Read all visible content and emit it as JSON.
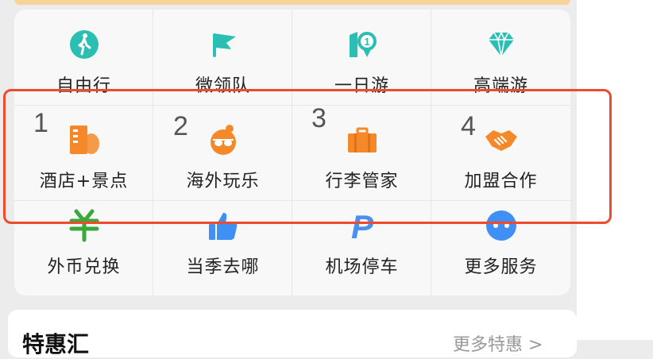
{
  "grid": {
    "row1": [
      {
        "label": "自由行",
        "icon": "hiking-icon"
      },
      {
        "label": "微领队",
        "icon": "flag-icon"
      },
      {
        "label": "一日游",
        "icon": "day-one-icon"
      },
      {
        "label": "高端游",
        "icon": "diamond-icon"
      }
    ],
    "row2": [
      {
        "label": "酒店+景点",
        "icon": "hotel-building-icon",
        "num": "1"
      },
      {
        "label": "海外玩乐",
        "icon": "sunglasses-face-icon",
        "num": "2"
      },
      {
        "label": "行李管家",
        "icon": "luggage-icon",
        "num": "3"
      },
      {
        "label": "加盟合作",
        "icon": "handshake-icon",
        "num": "4"
      }
    ],
    "row3": [
      {
        "label": "外币兑换",
        "icon": "currency-exchange-icon"
      },
      {
        "label": "当季去哪",
        "icon": "thumbs-up-icon"
      },
      {
        "label": "机场停车",
        "icon": "parking-icon"
      },
      {
        "label": "更多服务",
        "icon": "more-dots-icon"
      }
    ]
  },
  "bottom": {
    "title": "特惠汇",
    "link": "更多特惠 >"
  },
  "colors": {
    "teal": "#2bbfb3",
    "orange": "#f5892a",
    "blue": "#3f8ff5",
    "green": "#3aa83a",
    "highlight": "#ee4a2e"
  }
}
